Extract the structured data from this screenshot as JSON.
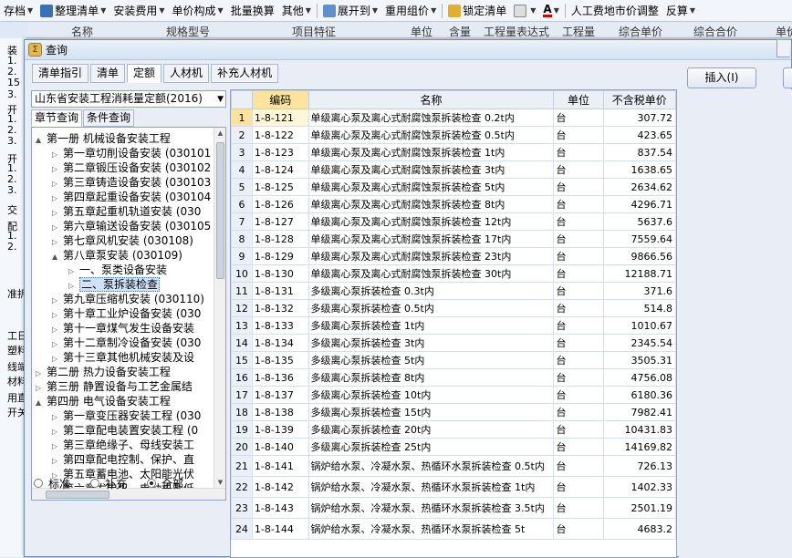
{
  "toolbar": {
    "items": [
      "存档",
      "整理清单",
      "安装费用",
      "单价构成",
      "批量换算",
      "其他",
      "展开到",
      "重用组价",
      "锁定清单",
      "",
      "人工费地市价调整",
      "反算"
    ]
  },
  "bg_table": {
    "headers": [
      "名称",
      "规格型号",
      "项目特征",
      "单位",
      "含量",
      "工程量表达式",
      "工程量",
      "综合单价",
      "综合合价",
      "单价"
    ]
  },
  "bg_left": {
    "texts": [
      "装",
      "1.",
      "2.",
      "15",
      "3.",
      "开",
      "1.",
      "2.",
      "3.",
      "开",
      "1.",
      "2.",
      "3.",
      "交",
      "配",
      "1.",
      "2.",
      "准拆",
      "工日",
      "塑料",
      "线端",
      "材料",
      "用直",
      "开关"
    ]
  },
  "dialog": {
    "title": "查询",
    "tabs": [
      "清单指引",
      "清单",
      "定额",
      "人材机",
      "补充人材机"
    ],
    "active_tab": "定额",
    "insert_label": "插入(I)",
    "library": "山东省安装工程消耗量定额(2016)",
    "subtabs": [
      "章节查询",
      "条件查询"
    ],
    "tree": [
      {
        "depth": 1,
        "toggle": "▲",
        "label": "第一册 机械设备安装工程"
      },
      {
        "depth": 2,
        "toggle": "▷",
        "label": "第一章切削设备安装 (030101"
      },
      {
        "depth": 2,
        "toggle": "▷",
        "label": "第二章锻压设备安装 (030102"
      },
      {
        "depth": 2,
        "toggle": "▷",
        "label": "第三章铸造设备安装 (030103"
      },
      {
        "depth": 2,
        "toggle": "▷",
        "label": "第四章起重设备安装 (030104"
      },
      {
        "depth": 2,
        "toggle": "▷",
        "label": "第五章起重机轨道安装 (030"
      },
      {
        "depth": 2,
        "toggle": "▷",
        "label": "第六章输送设备安装 (030105"
      },
      {
        "depth": 2,
        "toggle": "▷",
        "label": "第七章风机安装 (030108)"
      },
      {
        "depth": 2,
        "toggle": "▲",
        "label": "第八章泵安装 (030109)"
      },
      {
        "depth": 3,
        "toggle": "▷",
        "label": "一、泵类设备安装"
      },
      {
        "depth": 3,
        "toggle": "▷",
        "label": "二、泵拆装检查",
        "selected": true
      },
      {
        "depth": 2,
        "toggle": "▷",
        "label": "第九章压缩机安装 (030110)"
      },
      {
        "depth": 2,
        "toggle": "▷",
        "label": "第十章工业炉设备安装 (030"
      },
      {
        "depth": 2,
        "toggle": "▷",
        "label": "第十一章煤气发生设备安装"
      },
      {
        "depth": 2,
        "toggle": "▷",
        "label": "第十二章制冷设备安装 (030"
      },
      {
        "depth": 2,
        "toggle": "▷",
        "label": "第十三章其他机械安装及设"
      },
      {
        "depth": 1,
        "toggle": "▷",
        "label": "第二册 热力设备安装工程"
      },
      {
        "depth": 1,
        "toggle": "▷",
        "label": "第三册 静置设备与工艺金属结"
      },
      {
        "depth": 1,
        "toggle": "▲",
        "label": "第四册 电气设备安装工程"
      },
      {
        "depth": 2,
        "toggle": "▷",
        "label": "第一章变压器安装工程 (030"
      },
      {
        "depth": 2,
        "toggle": "▷",
        "label": "第二章配电装置安装工程 (0"
      },
      {
        "depth": 2,
        "toggle": "▷",
        "label": "第三章绝缘子、母线安装工"
      },
      {
        "depth": 2,
        "toggle": "▷",
        "label": "第四章配电控制、保护、直"
      },
      {
        "depth": 2,
        "toggle": "▷",
        "label": "第五章蓄电池、太阳能光伏"
      },
      {
        "depth": 2,
        "toggle": "▷",
        "label": "第六章发电机、电动机及低"
      }
    ],
    "radios": [
      {
        "label": "标准",
        "checked": false
      },
      {
        "label": "补充",
        "checked": false
      },
      {
        "label": "全部",
        "checked": true
      }
    ],
    "grid_headers": [
      "",
      "编码",
      "名称",
      "单位",
      "不含税单价"
    ],
    "rows": [
      {
        "n": "1",
        "code": "1-8-121",
        "name": "单级离心泵及离心式耐腐蚀泵拆装检查 0.2t内",
        "unit": "台",
        "price": "307.72"
      },
      {
        "n": "2",
        "code": "1-8-122",
        "name": "单级离心泵及离心式耐腐蚀泵拆装检查 0.5t内",
        "unit": "台",
        "price": "423.65"
      },
      {
        "n": "3",
        "code": "1-8-123",
        "name": "单级离心泵及离心式耐腐蚀泵拆装检查 1t内",
        "unit": "台",
        "price": "837.54"
      },
      {
        "n": "4",
        "code": "1-8-124",
        "name": "单级离心泵及离心式耐腐蚀泵拆装检查 3t内",
        "unit": "台",
        "price": "1638.65"
      },
      {
        "n": "5",
        "code": "1-8-125",
        "name": "单级离心泵及离心式耐腐蚀泵拆装检查 5t内",
        "unit": "台",
        "price": "2634.62"
      },
      {
        "n": "6",
        "code": "1-8-126",
        "name": "单级离心泵及离心式耐腐蚀泵拆装检查 8t内",
        "unit": "台",
        "price": "4296.71"
      },
      {
        "n": "7",
        "code": "1-8-127",
        "name": "单级离心泵及离心式耐腐蚀泵拆装检查 12t内",
        "unit": "台",
        "price": "5637.6"
      },
      {
        "n": "8",
        "code": "1-8-128",
        "name": "单级离心泵及离心式耐腐蚀泵拆装检查 17t内",
        "unit": "台",
        "price": "7559.64"
      },
      {
        "n": "9",
        "code": "1-8-129",
        "name": "单级离心泵及离心式耐腐蚀泵拆装检查 23t内",
        "unit": "台",
        "price": "9866.56"
      },
      {
        "n": "10",
        "code": "1-8-130",
        "name": "单级离心泵及离心式耐腐蚀泵拆装检查 30t内",
        "unit": "台",
        "price": "12188.71"
      },
      {
        "n": "11",
        "code": "1-8-131",
        "name": "多级离心泵拆装检查 0.3t内",
        "unit": "台",
        "price": "371.6"
      },
      {
        "n": "12",
        "code": "1-8-132",
        "name": "多级离心泵拆装检查 0.5t内",
        "unit": "台",
        "price": "514.8"
      },
      {
        "n": "13",
        "code": "1-8-133",
        "name": "多级离心泵拆装检查 1t内",
        "unit": "台",
        "price": "1010.67"
      },
      {
        "n": "14",
        "code": "1-8-134",
        "name": "多级离心泵拆装检查 3t内",
        "unit": "台",
        "price": "2345.54"
      },
      {
        "n": "15",
        "code": "1-8-135",
        "name": "多级离心泵拆装检查 5t内",
        "unit": "台",
        "price": "3505.31"
      },
      {
        "n": "16",
        "code": "1-8-136",
        "name": "多级离心泵拆装检查 8t内",
        "unit": "台",
        "price": "4756.08"
      },
      {
        "n": "17",
        "code": "1-8-137",
        "name": "多级离心泵拆装检查 10t内",
        "unit": "台",
        "price": "6180.36"
      },
      {
        "n": "18",
        "code": "1-8-138",
        "name": "多级离心泵拆装检查 15t内",
        "unit": "台",
        "price": "7982.41"
      },
      {
        "n": "19",
        "code": "1-8-139",
        "name": "多级离心泵拆装检查 20t内",
        "unit": "台",
        "price": "10431.83"
      },
      {
        "n": "20",
        "code": "1-8-140",
        "name": "多级离心泵拆装检查 25t内",
        "unit": "台",
        "price": "14169.82"
      },
      {
        "n": "21",
        "code": "1-8-141",
        "name": "锅炉给水泵、冷凝水泵、热循环水泵拆装检查 0.5t内",
        "unit": "台",
        "price": "726.13",
        "tall": true
      },
      {
        "n": "22",
        "code": "1-8-142",
        "name": "锅炉给水泵、冷凝水泵、热循环水泵拆装检查 1t内",
        "unit": "台",
        "price": "1402.33",
        "tall": true
      },
      {
        "n": "23",
        "code": "1-8-143",
        "name": "锅炉给水泵、冷凝水泵、热循环水泵拆装检查 3.5t内",
        "unit": "台",
        "price": "2501.19",
        "tall": true
      },
      {
        "n": "24",
        "code": "1-8-144",
        "name": "锅炉给水泵、冷凝水泵、热循环水泵拆装检查 5t",
        "unit": "台",
        "price": "4683.2",
        "tall": true
      }
    ]
  }
}
